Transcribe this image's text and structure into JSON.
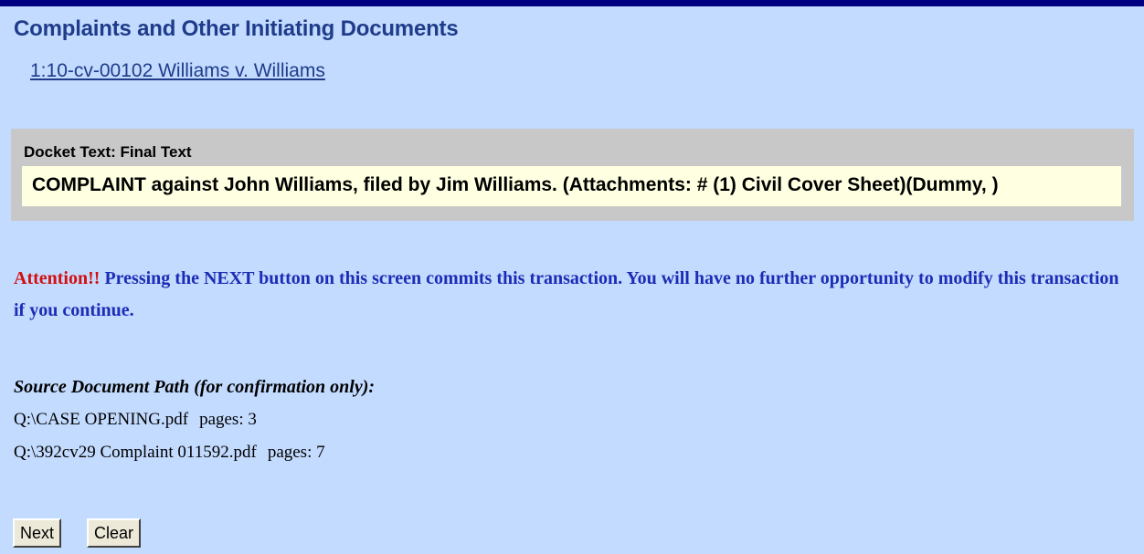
{
  "header": {
    "title": "Complaints and Other Initiating Documents",
    "case_link": "1:10-cv-00102 Williams v. Williams"
  },
  "docket": {
    "label": "Docket Text: Final Text",
    "text": "COMPLAINT against John Williams, filed by Jim Williams. (Attachments: # (1) Civil Cover Sheet)(Dummy, )"
  },
  "warning": {
    "attention": "Attention!!",
    "message": " Pressing the NEXT button on this screen commits this transaction. You will have no further opportunity to modify this transaction if you continue."
  },
  "source": {
    "heading": "Source Document Path (for confirmation only):",
    "documents": [
      {
        "path": "Q:\\CASE OPENING.pdf",
        "pages": "pages: 3"
      },
      {
        "path": "Q:\\392cv29 Complaint 011592.pdf",
        "pages": "pages: 7"
      }
    ]
  },
  "buttons": {
    "next": "Next",
    "clear": "Clear"
  },
  "colors": {
    "background": "#c3dbff",
    "top_rule": "#000080",
    "title": "#1f3c8a",
    "docket_panel": "#c8c8c8",
    "docket_text_bg": "#ffffe1",
    "attention": "#d10f0f",
    "warning_text": "#1c2cb5"
  }
}
